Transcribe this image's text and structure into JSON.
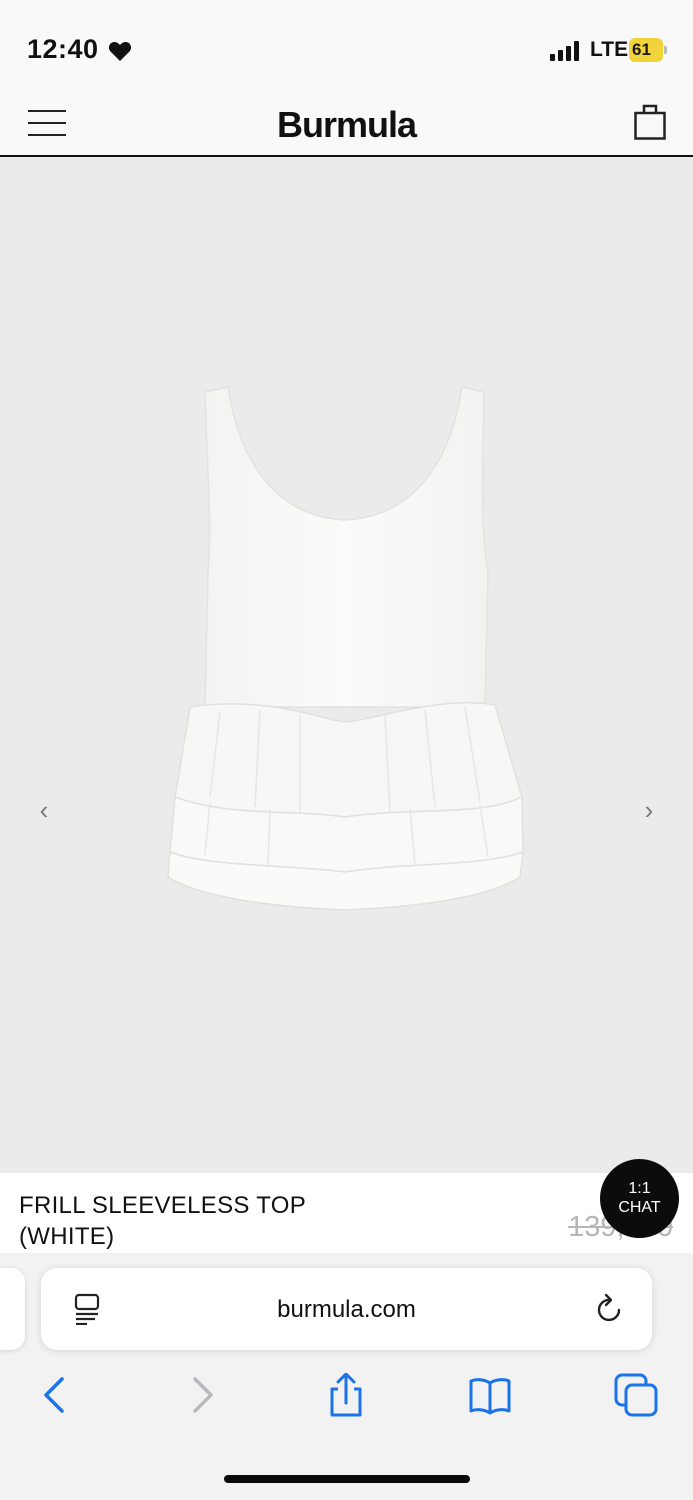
{
  "status_bar": {
    "time": "12:40",
    "network": "LTE",
    "battery": "61"
  },
  "header": {
    "brand": "Burmula",
    "menu_icon": "hamburger-menu-icon",
    "cart_icon": "shopping-bag-icon"
  },
  "product": {
    "name": "FRILL SLEEVELESS TOP (WHITE)",
    "price_original": "139,000",
    "image_alt": "white frill sleeveless top",
    "prev_arrow": "‹",
    "next_arrow": "›"
  },
  "chat": {
    "line1": "1:1",
    "line2": "CHAT"
  },
  "browser": {
    "url": "burmula.com",
    "accent": "#1a73e8"
  }
}
